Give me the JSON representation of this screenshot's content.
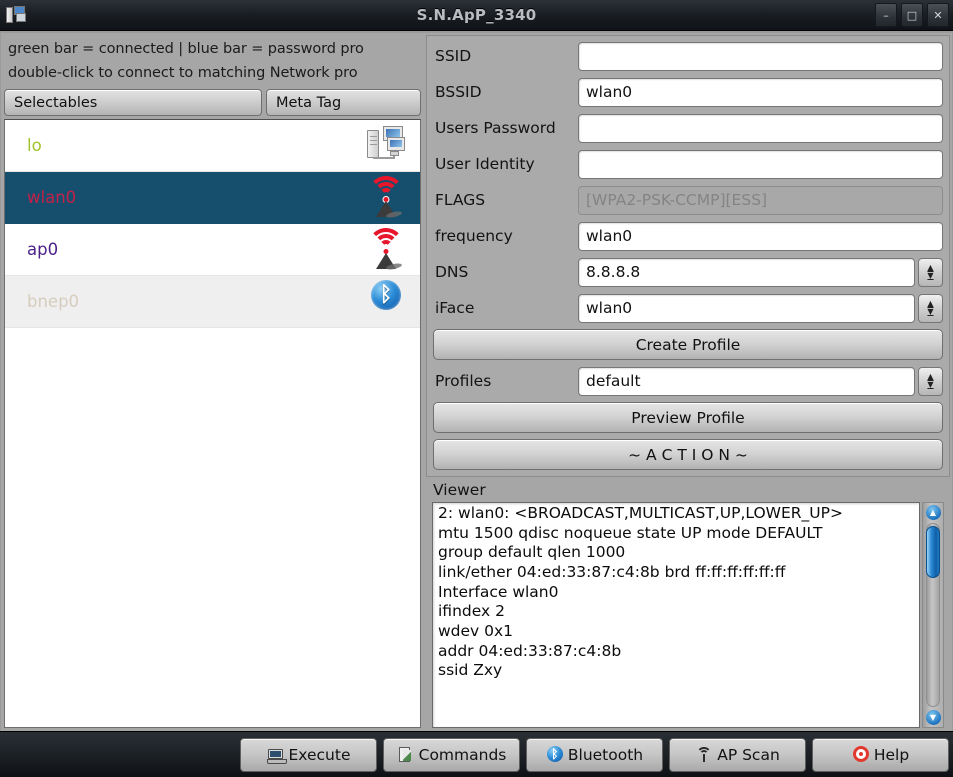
{
  "window": {
    "title": "S.N.ApP_3340",
    "icon": "network-computers-icon",
    "controls": {
      "minimize": "–",
      "maximize": "□",
      "close": "✕"
    }
  },
  "left_panel": {
    "hint_line1": "green bar = connected | blue bar = password pro",
    "hint_line2": "double-click to connect to matching Network pro",
    "tabs": [
      {
        "label": "Selectables",
        "name": "tab-selectables"
      },
      {
        "label": "Meta Tag",
        "name": "tab-meta-tag"
      }
    ],
    "interfaces": [
      {
        "label": "lo",
        "icon": "network-computers-icon",
        "color": "#9fc32a",
        "selected": false,
        "row_style": "white"
      },
      {
        "label": "wlan0",
        "icon": "wifi-antenna-icon",
        "color": "#c42048",
        "selected": true,
        "row_style": "selected"
      },
      {
        "label": "ap0",
        "icon": "wifi-antenna-icon",
        "color": "#4a1f8a",
        "selected": false,
        "row_style": "white"
      },
      {
        "label": "bnep0",
        "icon": "bluetooth-icon",
        "color": "#d6cdbe",
        "selected": false,
        "row_style": "alt"
      }
    ]
  },
  "form": {
    "fields": [
      {
        "label": "SSID",
        "value": "",
        "name": "ssid",
        "spinner": false,
        "disabled": false
      },
      {
        "label": "BSSID",
        "value": "wlan0",
        "name": "bssid",
        "spinner": false,
        "disabled": false
      },
      {
        "label": "Users Password",
        "value": "",
        "name": "users-password",
        "spinner": false,
        "disabled": false
      },
      {
        "label": "User Identity",
        "value": "",
        "name": "user-identity",
        "spinner": false,
        "disabled": false
      },
      {
        "label": "FLAGS",
        "value": "[WPA2-PSK-CCMP][ESS]",
        "name": "flags",
        "spinner": false,
        "disabled": true
      },
      {
        "label": "frequency",
        "value": "wlan0",
        "name": "frequency",
        "spinner": false,
        "disabled": false
      },
      {
        "label": "DNS",
        "value": "8.8.8.8",
        "name": "dns",
        "spinner": true,
        "disabled": false
      },
      {
        "label": "iFace",
        "value": "wlan0",
        "name": "iface",
        "spinner": true,
        "disabled": false
      }
    ],
    "create_profile_label": "Create Profile",
    "profiles_label": "Profiles",
    "profiles_value": "default",
    "preview_profile_label": "Preview Profile",
    "action_label": "~ A C T I O N ~"
  },
  "viewer": {
    "label": "Viewer",
    "text": "2: wlan0: <BROADCAST,MULTICAST,UP,LOWER_UP>\nmtu 1500 qdisc noqueue state UP mode DEFAULT\ngroup default qlen 1000\nlink/ether 04:ed:33:87:c4:8b brd ff:ff:ff:ff:ff:ff\nInterface wlan0\nifindex 2\nwdev 0x1\naddr 04:ed:33:87:c4:8b\nssid Zxy",
    "scroll_up": "▲",
    "scroll_down": "▼"
  },
  "toolbar": {
    "buttons": [
      {
        "label": "Execute",
        "icon": "laptop-icon",
        "name": "execute-button"
      },
      {
        "label": "Commands",
        "icon": "notepad-icon",
        "name": "commands-button"
      },
      {
        "label": "Bluetooth",
        "icon": "bluetooth-icon",
        "name": "bluetooth-button"
      },
      {
        "label": "AP Scan",
        "icon": "antenna-icon",
        "name": "ap-scan-button"
      },
      {
        "label": "Help",
        "icon": "lifebuoy-icon",
        "name": "help-button"
      }
    ]
  },
  "colors": {
    "selected_row": "#164f6e",
    "panel": "#a6a6a6",
    "titlebar": "#1b1f24",
    "accent_blue": "#1d74c0",
    "accent_red": "#e8162b"
  }
}
